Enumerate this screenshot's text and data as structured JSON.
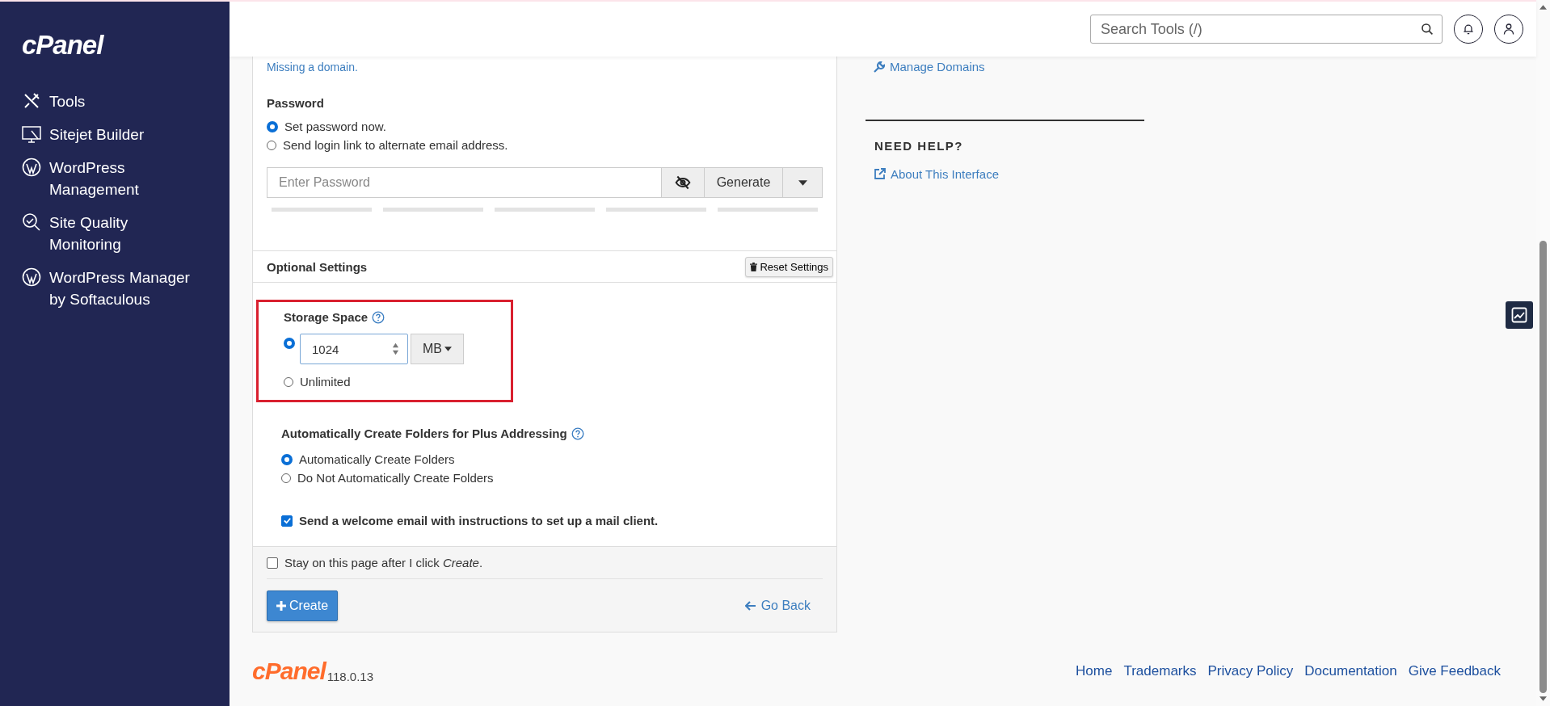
{
  "sidebar": {
    "logo": "cPanel",
    "items": [
      {
        "kind": "tools",
        "label": "Tools"
      },
      {
        "kind": "sitejet",
        "label": "Sitejet Builder"
      },
      {
        "kind": "wordpress",
        "label": "WordPress Management"
      },
      {
        "kind": "quality",
        "label": "Site Quality Monitoring"
      },
      {
        "kind": "wordpress",
        "label": "WordPress Manager by Softaculous"
      }
    ]
  },
  "header": {
    "search": {
      "placeholder": "Search Tools (/)"
    }
  },
  "form": {
    "missing_link": "Missing a domain.",
    "password": {
      "label": "Password",
      "options": [
        {
          "label": "Set password now.",
          "selected": true
        },
        {
          "label": "Send login link to alternate email address.",
          "selected": false
        }
      ],
      "input": {
        "placeholder": "Enter Password"
      },
      "generate": "Generate",
      "strength": {
        "level": 0
      }
    },
    "optional": {
      "title": "Optional Settings",
      "reset": "Reset Settings",
      "storage": {
        "label": "Storage Space",
        "options": [
          {
            "kind": "quota",
            "selected": true,
            "value": "1024",
            "unit": "MB"
          },
          {
            "kind": "plain",
            "selected": false,
            "label": "Unlimited"
          }
        ]
      },
      "folders": {
        "label": "Automatically Create Folders for Plus Addressing",
        "options": [
          {
            "label": "Automatically Create Folders",
            "selected": true
          },
          {
            "label": "Do Not Automatically Create Folders",
            "selected": false
          }
        ]
      },
      "welcome": {
        "label": "Send a welcome email with instructions to set up a mail client.",
        "checked": true
      }
    },
    "footer": {
      "stay": {
        "label": "Stay on this page after I click *Create*.",
        "checked": false
      },
      "create": "Create",
      "back": "Go Back"
    }
  },
  "right": {
    "manage_link": "Manage Domains",
    "help_title": "NEED HELP?",
    "about_link": "About This Interface"
  },
  "page_footer": {
    "logo": "cPanel",
    "version": "118.0.13",
    "links": [
      "Home",
      "Trademarks",
      "Privacy Policy",
      "Documentation",
      "Give Feedback"
    ]
  }
}
